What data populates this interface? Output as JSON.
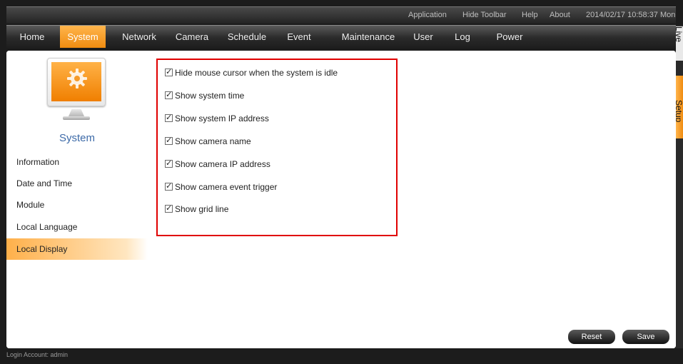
{
  "toolbar": {
    "application": "Application",
    "hide_toolbar": "Hide Toolbar",
    "help": "Help",
    "about": "About",
    "datetime": "2014/02/17 10:58:37 Mon"
  },
  "nav": {
    "items": [
      {
        "label": "Home"
      },
      {
        "label": "System"
      },
      {
        "label": "Network"
      },
      {
        "label": "Camera"
      },
      {
        "label": "Schedule"
      },
      {
        "label": "Event"
      },
      {
        "label": "Maintenance"
      },
      {
        "label": "User"
      },
      {
        "label": "Log"
      },
      {
        "label": "Power"
      }
    ],
    "active": "System"
  },
  "right_tabs": {
    "live": "Live",
    "setup": "Setup",
    "active": "Setup"
  },
  "sidebar": {
    "icon": "monitor-gear-icon",
    "title": "System",
    "items": [
      {
        "label": "Information"
      },
      {
        "label": "Date and Time"
      },
      {
        "label": "Module"
      },
      {
        "label": "Local Language"
      },
      {
        "label": "Local Display"
      }
    ],
    "active": "Local Display"
  },
  "options": [
    {
      "label": "Hide mouse cursor when the system is idle",
      "checked": true
    },
    {
      "label": "Show system time",
      "checked": true
    },
    {
      "label": "Show system IP address",
      "checked": true
    },
    {
      "label": "Show camera name",
      "checked": true
    },
    {
      "label": "Show camera IP address",
      "checked": true
    },
    {
      "label": "Show camera event trigger",
      "checked": true
    },
    {
      "label": "Show grid line",
      "checked": true
    }
  ],
  "buttons": {
    "reset": "Reset",
    "save": "Save"
  },
  "footer": {
    "login": "Login Account: admin"
  },
  "colors": {
    "accent": "#f39a1f",
    "highlight_box": "#e00000",
    "sidebar_title": "#3d6aa8"
  }
}
